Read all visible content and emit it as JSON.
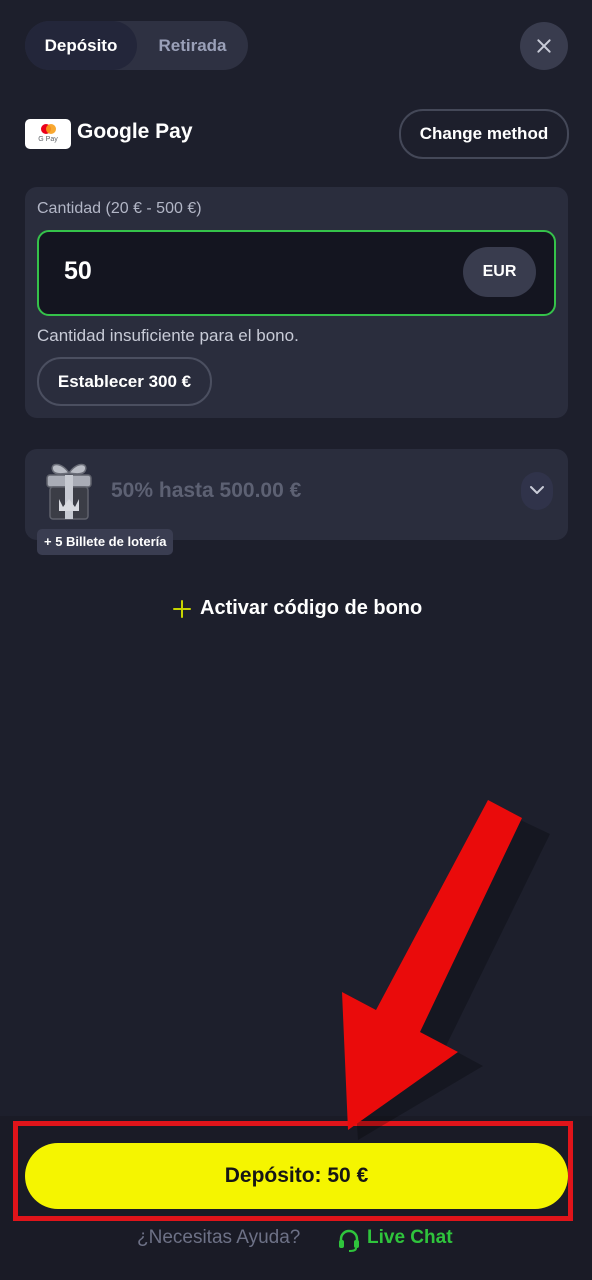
{
  "tabs": [
    {
      "label": "Depósito",
      "active": true
    },
    {
      "label": "Retirada",
      "active": false
    }
  ],
  "payment_method": {
    "logo_text": "G Pay",
    "name": "Google Pay",
    "change_label": "Change method"
  },
  "amount": {
    "label": "Cantidad (20 € - 500 €)",
    "value": "50",
    "currency": "EUR",
    "warning": "Cantidad insuficiente para el bono.",
    "set_amount_label": "Establecer 300 €"
  },
  "bonus": {
    "text": "50% hasta 500.00 €",
    "badge": "+ 5 Billete de lotería",
    "promo_label": "Activar código de bono"
  },
  "footer": {
    "deposit_label": "Depósito: 50 €",
    "help_text": "¿Necesitas Ayuda?",
    "live_chat_label": "Live Chat"
  },
  "colors": {
    "background": "#1d1f2c",
    "accent_yellow": "#f5f500",
    "input_border_green": "#35c24a",
    "live_chat_green": "#2fc43c",
    "annotation_red": "#e0141a"
  }
}
